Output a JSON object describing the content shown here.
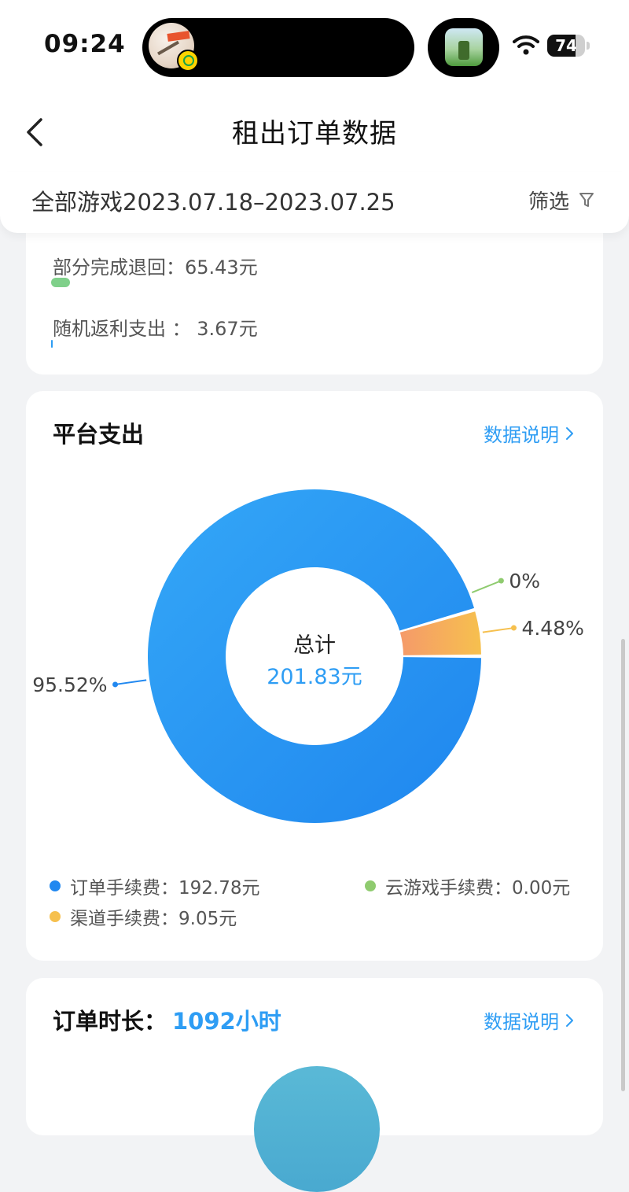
{
  "status_bar": {
    "time": "09:24",
    "battery": "74",
    "battery_level": 0.74
  },
  "nav": {
    "title": "租出订单数据"
  },
  "filter": {
    "range": "全部游戏2023.07.18–2023.07.25",
    "button_label": "筛选"
  },
  "refund_card": {
    "items": [
      {
        "label": "部分完成退回：65.43元",
        "color": "#7fd08a"
      },
      {
        "label": "随机返利支出 ： 3.67元",
        "color": "#2e9df4"
      }
    ]
  },
  "platform_card": {
    "title": "平台支出",
    "link": "数据说明",
    "center_label": "总计",
    "center_value": "201.83元",
    "legend": [
      {
        "label": "订单手续费：192.78元",
        "color": "#2188f0"
      },
      {
        "label": "云游戏手续费：0.00元",
        "color": "#8fcb6f"
      },
      {
        "label": "渠道手续费：9.05元",
        "color": "#f6c04e"
      }
    ]
  },
  "duration_card": {
    "title": "订单时长：",
    "value": "1092小时",
    "link": "数据说明"
  },
  "chart_data": {
    "type": "pie",
    "title": "平台支出",
    "categories": [
      "订单手续费",
      "云游戏手续费",
      "渠道手续费"
    ],
    "values": [
      192.78,
      0.0,
      9.05
    ],
    "percent_labels": [
      "95.52%",
      "0%",
      "4.48%"
    ],
    "colors": [
      "#2188f0",
      "#8fcb6f",
      "#f6c04e"
    ],
    "center_text": "总计",
    "center_value": "201.83元",
    "legend_position": "bottom"
  }
}
